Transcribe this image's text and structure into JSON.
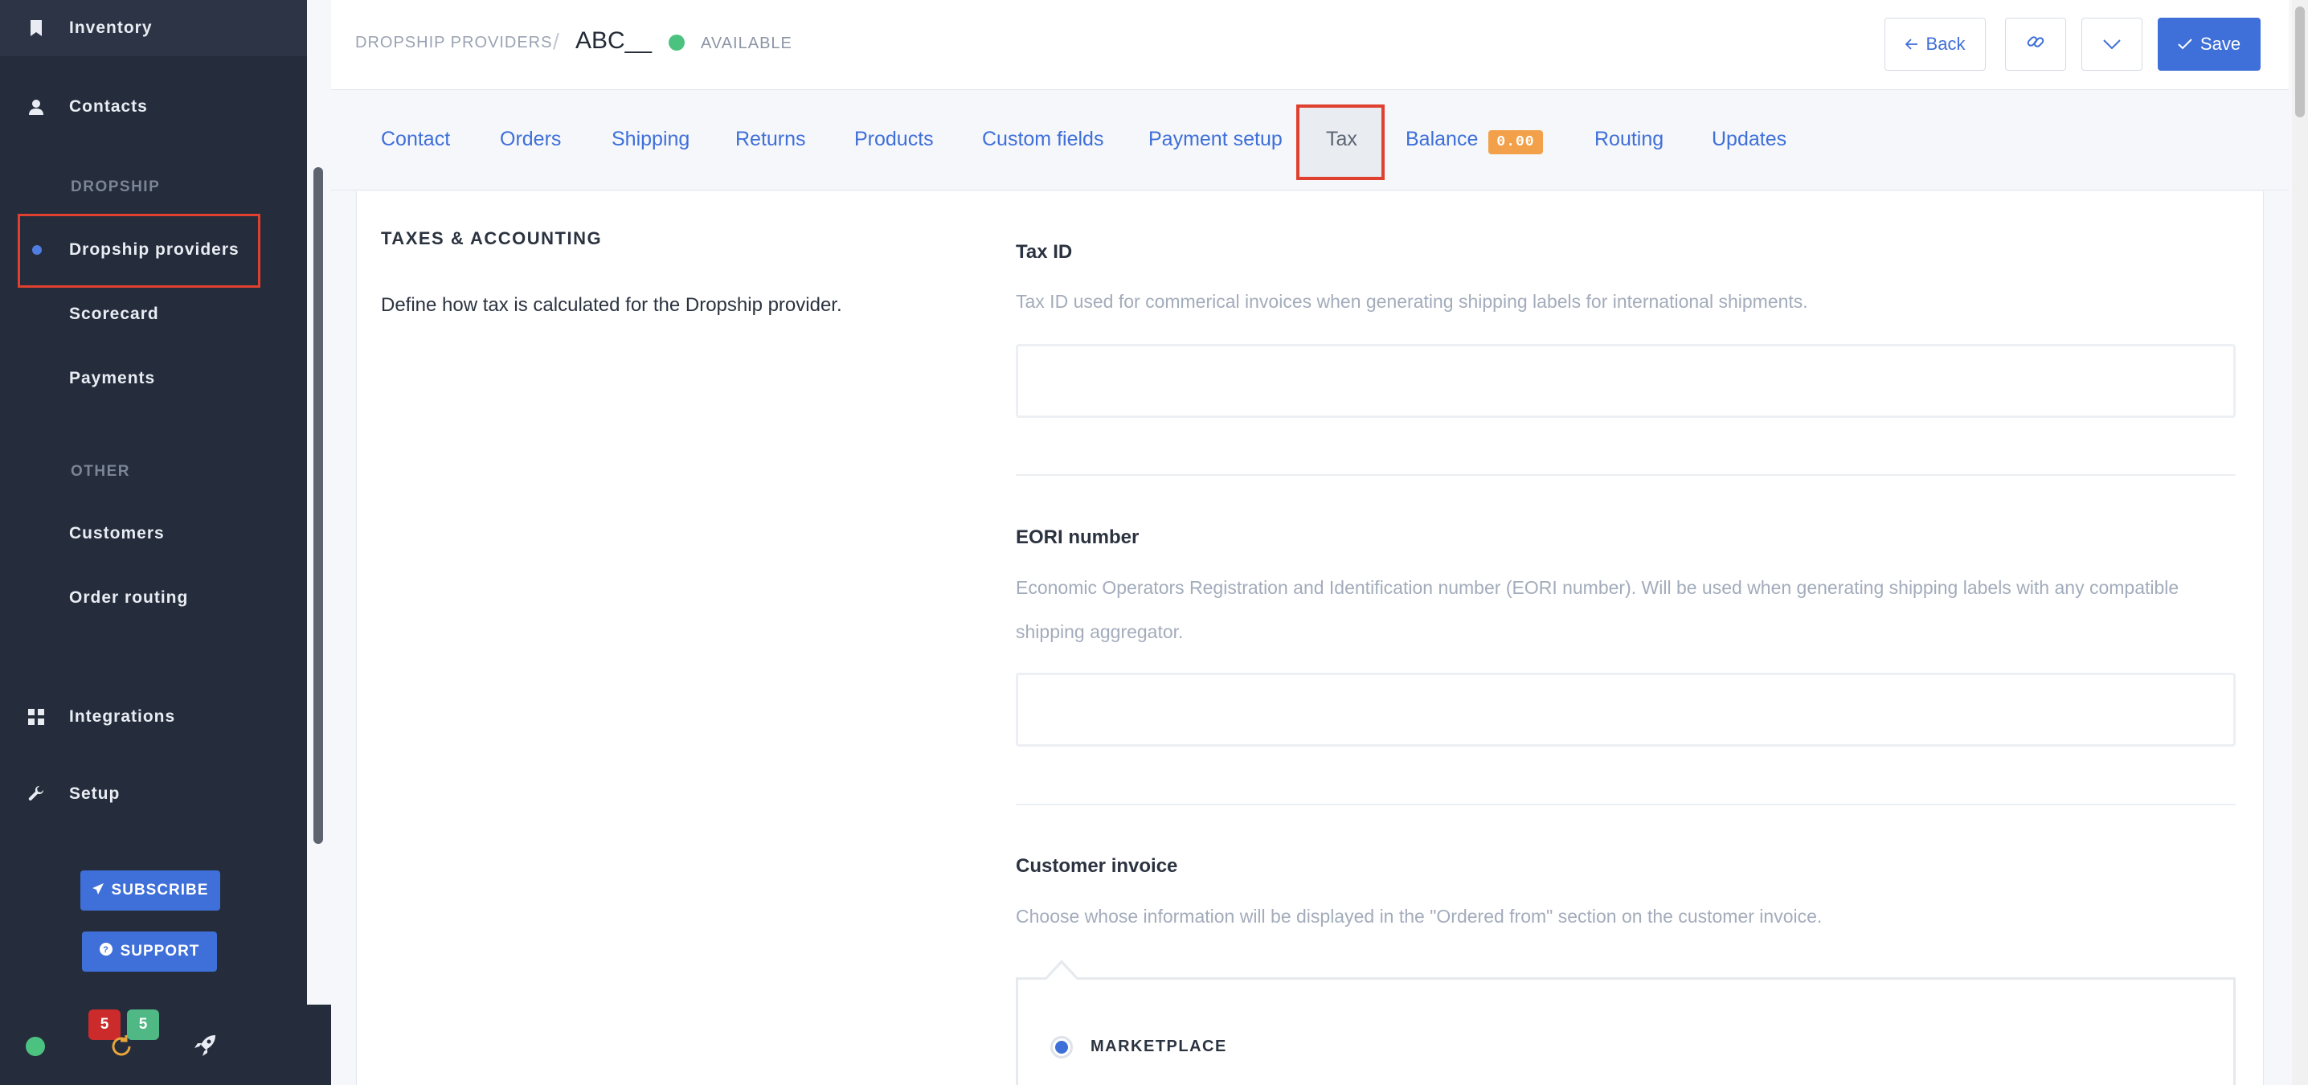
{
  "sidebar": {
    "nav": {
      "inventory": "Inventory",
      "contacts": "Contacts",
      "dropship_section": "DROPSHIP",
      "dropship_providers": "Dropship providers",
      "scorecard": "Scorecard",
      "payments": "Payments",
      "other_section": "OTHER",
      "customers": "Customers",
      "order_routing": "Order routing",
      "integrations": "Integrations",
      "setup": "Setup"
    },
    "subscribe_label": "SUBSCRIBE",
    "support_label": "SUPPORT",
    "badges": {
      "red": "5",
      "green": "5"
    },
    "colors": {
      "online": "#4cc281",
      "refresh": "#e8a53c"
    }
  },
  "header": {
    "breadcrumb": "DROPSHIP PROVIDERS",
    "separator": "/",
    "record_name": "ABC__",
    "status": "AVAILABLE",
    "status_color": "#4cc281",
    "back_label": "Back",
    "save_label": "Save",
    "icons": {
      "back": "arrow-left-icon",
      "link": "link-icon",
      "more": "chevron-down-icon",
      "save": "check-icon"
    }
  },
  "tabs": {
    "contact": "Contact",
    "orders": "Orders",
    "shipping": "Shipping",
    "returns": "Returns",
    "products": "Products",
    "custom_fields": "Custom fields",
    "payment_setup": "Payment setup",
    "tax": "Tax",
    "balance": "Balance",
    "balance_value": "0.00",
    "routing": "Routing",
    "updates": "Updates",
    "active": "Tax"
  },
  "main": {
    "section_title": "TAXES & ACCOUNTING",
    "section_desc": "Define how tax is calculated for the Dropship provider.",
    "tax_id": {
      "label": "Tax ID",
      "help": "Tax ID used for commerical invoices when generating shipping labels for international shipments.",
      "value": ""
    },
    "eori": {
      "label": "EORI number",
      "help": "Economic Operators Registration and Identification number (EORI number). Will be used when generating shipping labels with any compatible shipping aggregator.",
      "value": ""
    },
    "customer_invoice": {
      "label": "Customer invoice",
      "help": "Choose whose information will be displayed in the \"Ordered from\" section on the customer invoice.",
      "option": "MARKETPLACE",
      "selected": true
    }
  },
  "colors": {
    "accent": "#3f6fd8",
    "highlight": "#e0402f",
    "sidebar": "#252c3b",
    "balance_badge": "#f2a14a"
  }
}
